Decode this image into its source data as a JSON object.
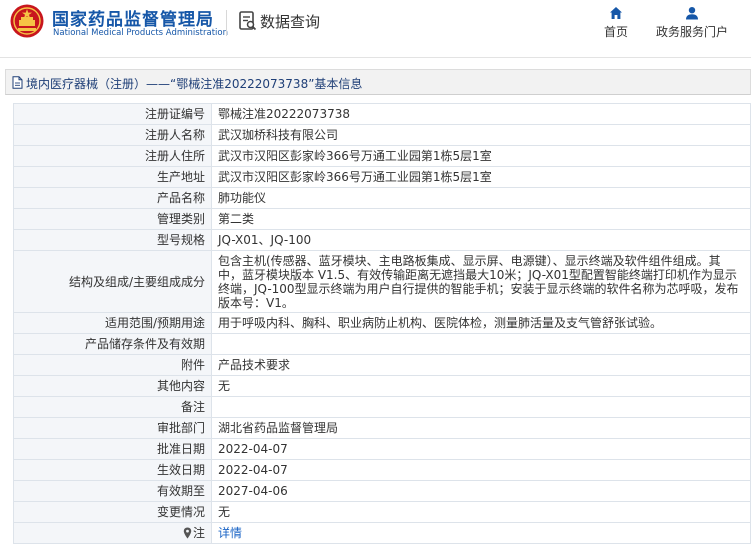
{
  "header": {
    "brand_cn": "国家药品监督管理局",
    "brand_en": "National Medical Products Administration",
    "query_title": "数据查询",
    "nav": [
      {
        "label": "首页",
        "icon": "home-icon"
      },
      {
        "label": "政务服务门户",
        "icon": "user-icon"
      }
    ]
  },
  "breadcrumb": {
    "text": "境内医疗器械（注册）——“鄂械注准20222073738”基本信息"
  },
  "detail": {
    "rows": [
      {
        "label": "注册证编号",
        "value": "鄂械注准20222073738"
      },
      {
        "label": "注册人名称",
        "value": "武汉珈桥科技有限公司"
      },
      {
        "label": "注册人住所",
        "value": "武汉市汉阳区彭家岭366号万通工业园第1栋5层1室"
      },
      {
        "label": "生产地址",
        "value": "武汉市汉阳区彭家岭366号万通工业园第1栋5层1室"
      },
      {
        "label": "产品名称",
        "value": "肺功能仪"
      },
      {
        "label": "管理类别",
        "value": "第二类"
      },
      {
        "label": "型号规格",
        "value": "JQ-X01、JQ-100"
      },
      {
        "label": "结构及组成/主要组成成分",
        "value": "包含主机(传感器、蓝牙模块、主电路板集成、显示屏、电源键）、显示终端及软件组件组成。其中，蓝牙模块版本 V1.5、有效传输距离无遮挡最大10米；JQ-X01型配置智能终端打印机作为显示终端，JQ-100型显示终端为用户自行提供的智能手机；安装于显示终端的软件名称为芯呼吸，发布版本号：V1。"
      },
      {
        "label": "适用范围/预期用途",
        "value": "用于呼吸内科、胸科、职业病防止机构、医院体检，测量肺活量及支气管舒张试验。"
      },
      {
        "label": "产品储存条件及有效期",
        "value": ""
      },
      {
        "label": "附件",
        "value": "产品技术要求"
      },
      {
        "label": "其他内容",
        "value": "无"
      },
      {
        "label": "备注",
        "value": ""
      },
      {
        "label": "审批部门",
        "value": "湖北省药品监督管理局"
      },
      {
        "label": "批准日期",
        "value": "2022-04-07"
      },
      {
        "label": "生效日期",
        "value": "2022-04-07"
      },
      {
        "label": "有效期至",
        "value": "2027-04-06"
      },
      {
        "label": "变更情况",
        "value": "无"
      }
    ],
    "note": {
      "label": "注",
      "icon": "pin-icon",
      "value": "详情"
    }
  },
  "colors": {
    "brand_blue": "#1657a8",
    "emblem_red": "#c8161d",
    "link_blue": "#1a64c6"
  }
}
